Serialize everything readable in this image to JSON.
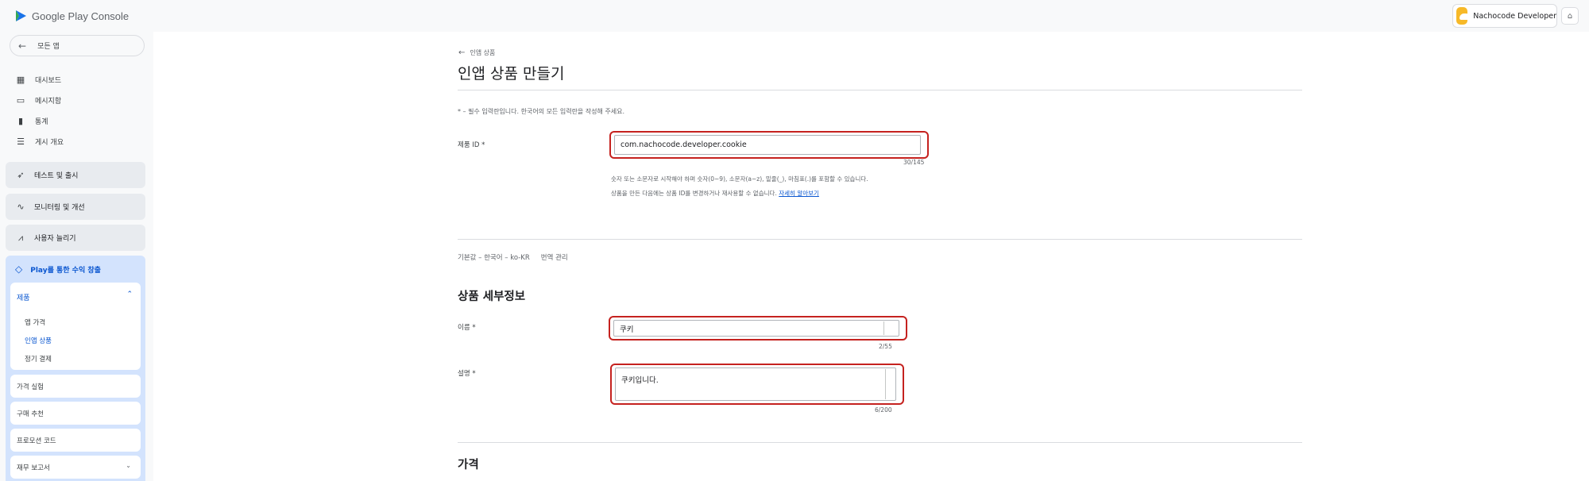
{
  "header": {
    "brand_google": "Google Play",
    "brand_console": "Console",
    "account_name": "Nachocode Developer"
  },
  "sidebar": {
    "back_label": "모든 앱",
    "items": [
      {
        "label": "대시보드",
        "icon": "dashboard-icon"
      },
      {
        "label": "메시지함",
        "icon": "inbox-icon"
      },
      {
        "label": "통계",
        "icon": "bar-chart-icon"
      },
      {
        "label": "게시 개요",
        "icon": "publishing-overview-icon"
      }
    ],
    "sections": [
      {
        "label": "테스트 및 출시",
        "icon": "rocket-icon"
      },
      {
        "label": "모니터링 및 개선",
        "icon": "pulse-icon"
      },
      {
        "label": "사용자 늘리기",
        "icon": "growth-chart-icon"
      }
    ],
    "monetize": {
      "label": "Play를 통한 수익 창출",
      "icon": "tag-icon",
      "products_label": "제품",
      "sub_items": [
        "앱 가격",
        "인앱 상품",
        "정기 결제"
      ],
      "active_sub": "인앱 상품",
      "cards": [
        "가격 실험",
        "구매 추천",
        "프로모션 코드",
        "재무 보고서"
      ]
    }
  },
  "main": {
    "breadcrumb": "인앱 상품",
    "title": "인앱 상품 만들기",
    "required_note": "* – 필수 입력란입니다. 한국어의 모든 입력란을 작성해 주세요.",
    "product_id": {
      "label": "제품 ID *",
      "value": "com.nachocode.developer.cookie",
      "counter": "30/145",
      "help1": "숫자 또는 소문자로 시작해야 하며 숫자(0~9), 소문자(a~z), 밑줄(_), 마침표(.)를 포함할 수 있습니다.",
      "help2": "상품을 만든 다음에는 상품 ID를 변경하거나 재사용할 수 없습니다.",
      "help_link": "자세히 알아보기"
    },
    "language": {
      "default": "기본값 – 한국어 – ko-KR",
      "manage": "번역 관리"
    },
    "details_title": "상품 세부정보",
    "name": {
      "label": "이름 *",
      "value": "쿠키",
      "counter": "2/55"
    },
    "description": {
      "label": "설명 *",
      "value": "쿠키입니다.",
      "counter": "6/200"
    },
    "price_title": "가격"
  },
  "colors": {
    "accent": "#0b57d0",
    "highlight": "#c5221f",
    "sidebar_bg": "#f8f9fa",
    "monetize_bg": "#d3e3fd"
  }
}
